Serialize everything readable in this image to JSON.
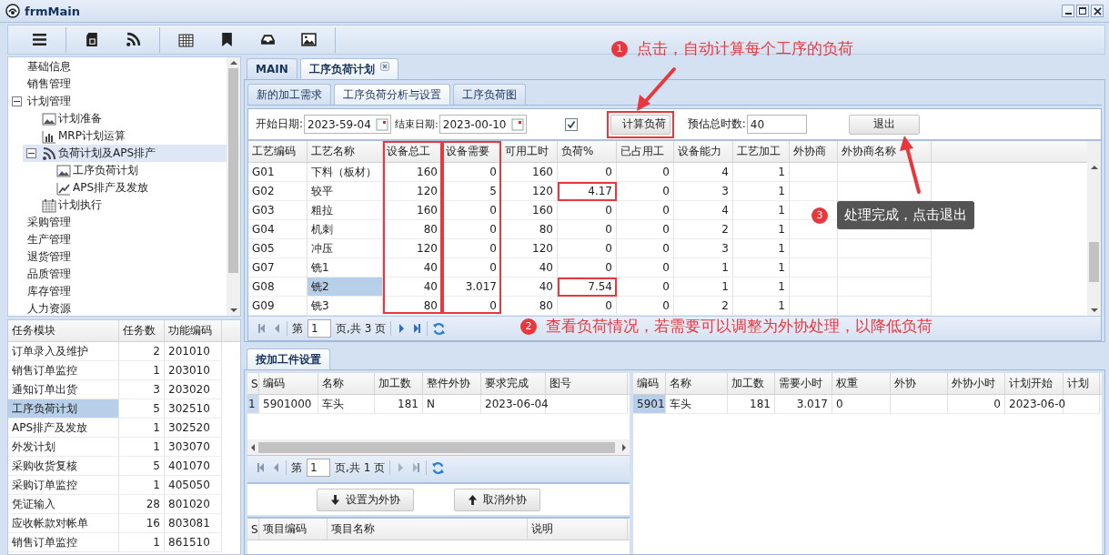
{
  "window": {
    "title": "frmMain"
  },
  "tree": [
    {
      "label": "基础信息",
      "selected": false
    },
    {
      "label": "销售管理",
      "selected": false
    },
    {
      "label": "计划管理",
      "selected": false,
      "expanded": true,
      "children": [
        {
          "label": "计划准备",
          "kind": "image",
          "selected": false
        },
        {
          "label": "MRP计划运算",
          "kind": "bars",
          "selected": false
        },
        {
          "label": "负荷计划及APS排产",
          "kind": "feed",
          "selected": true,
          "expanded": true,
          "children": [
            {
              "label": "工序负荷计划",
              "kind": "image",
              "selected": false
            },
            {
              "label": "APS排产及发放",
              "kind": "line",
              "selected": false
            }
          ]
        },
        {
          "label": "计划执行",
          "kind": "calendar",
          "selected": false
        }
      ]
    },
    {
      "label": "采购管理",
      "selected": false
    },
    {
      "label": "生产管理",
      "selected": false
    },
    {
      "label": "退货管理",
      "selected": false
    },
    {
      "label": "品质管理",
      "selected": false
    },
    {
      "label": "库存管理",
      "selected": false
    },
    {
      "label": "人力资源",
      "selected": false
    }
  ],
  "tasks": {
    "columns": [
      {
        "label": "任务模块",
        "kind": "text"
      },
      {
        "label": "任务数",
        "kind": "number"
      },
      {
        "label": "功能编码",
        "kind": "text"
      }
    ],
    "rows": [
      {
        "cells": [
          "订单录入及维护",
          "2",
          "201010"
        ],
        "selected": false
      },
      {
        "cells": [
          "销售订单监控",
          "1",
          "203010"
        ],
        "selected": false
      },
      {
        "cells": [
          "通知订单出货",
          "3",
          "203020"
        ],
        "selected": false
      },
      {
        "cells": [
          "工序负荷计划",
          "5",
          "302510"
        ],
        "selected": true
      },
      {
        "cells": [
          "APS排产及发放",
          "1",
          "302520"
        ],
        "selected": false
      },
      {
        "cells": [
          "外发计划",
          "1",
          "303070"
        ],
        "selected": false
      },
      {
        "cells": [
          "采购收货复核",
          "5",
          "401070"
        ],
        "selected": false
      },
      {
        "cells": [
          "采购订单监控",
          "1",
          "405050"
        ],
        "selected": false
      },
      {
        "cells": [
          "凭证输入",
          "28",
          "801020"
        ],
        "selected": false
      },
      {
        "cells": [
          "应收帐款对帐单",
          "16",
          "803081"
        ],
        "selected": false
      },
      {
        "cells": [
          "销售订单监控",
          "1",
          "861510"
        ],
        "selected": false
      }
    ]
  },
  "tabs": [
    {
      "label": "MAIN",
      "selected": false,
      "closable": false
    },
    {
      "label": "工序负荷计划",
      "selected": true,
      "closable": true
    }
  ],
  "subtabs": [
    {
      "label": "新的加工需求",
      "selected": false
    },
    {
      "label": "工序负荷分析与设置",
      "selected": true
    },
    {
      "label": "工序负荷图",
      "selected": false
    }
  ],
  "form": {
    "start_label": "开始日期:",
    "start_value": "2023-59-04",
    "end_label": "结束日期:",
    "end_value": "2023-00-10",
    "checked": true,
    "calc_button": "计算负荷",
    "calc_highlighted": true,
    "estimate_label": "预估总时数:",
    "estimate_value": "40",
    "exit_button": "退出"
  },
  "load_grid": {
    "columns": [
      {
        "label": "工艺编码",
        "kind": "text",
        "highlighted": false
      },
      {
        "label": "工艺名称",
        "kind": "text",
        "highlighted": false
      },
      {
        "label": "设备总工",
        "kind": "number",
        "highlighted": true
      },
      {
        "label": "设备需要",
        "kind": "number",
        "highlighted": true
      },
      {
        "label": "可用工时",
        "kind": "number",
        "highlighted": false
      },
      {
        "label": "负荷%",
        "kind": "number",
        "highlighted": false
      },
      {
        "label": "已占用工",
        "kind": "number",
        "highlighted": false
      },
      {
        "label": "设备能力",
        "kind": "number",
        "highlighted": false
      },
      {
        "label": "工艺加工",
        "kind": "number",
        "highlighted": false
      },
      {
        "label": "外协商",
        "highlighted": false
      },
      {
        "label": "外协商名称",
        "highlighted": false
      }
    ],
    "rows": [
      {
        "cells": [
          "G01",
          "下料（板材）",
          "160",
          "0",
          "160",
          "0",
          "0",
          "4",
          "1",
          "",
          ""
        ],
        "selected": false,
        "flagged": false
      },
      {
        "cells": [
          "G02",
          "较平",
          "120",
          "5",
          "120",
          "4.17",
          "0",
          "3",
          "1",
          "",
          ""
        ],
        "selected": false,
        "flagged": true
      },
      {
        "cells": [
          "G03",
          "粗拉",
          "160",
          "0",
          "160",
          "0",
          "0",
          "4",
          "1",
          "",
          ""
        ],
        "selected": false,
        "flagged": false
      },
      {
        "cells": [
          "G04",
          "机刺",
          "80",
          "0",
          "80",
          "0",
          "0",
          "2",
          "1",
          "",
          ""
        ],
        "selected": false,
        "flagged": false
      },
      {
        "cells": [
          "G05",
          "冲压",
          "120",
          "0",
          "120",
          "0",
          "0",
          "3",
          "1",
          "",
          ""
        ],
        "selected": false,
        "flagged": false
      },
      {
        "cells": [
          "G07",
          "铣1",
          "40",
          "0",
          "40",
          "0",
          "0",
          "1",
          "1",
          "",
          ""
        ],
        "selected": false,
        "flagged": false
      },
      {
        "cells": [
          "G08",
          "铣2",
          "40",
          "3.017",
          "40",
          "7.54",
          "0",
          "1",
          "1",
          "",
          ""
        ],
        "selected": true,
        "flagged": true
      },
      {
        "cells": [
          "G09",
          "铣3",
          "80",
          "0",
          "80",
          "0",
          "0",
          "2",
          "1",
          "",
          ""
        ],
        "selected": false,
        "flagged": false
      }
    ]
  },
  "pager": {
    "page_label": "第",
    "page": "1",
    "total": "页,共 3 页",
    "nav_enabled": true
  },
  "lower_tab": {
    "label": "按加工件设置",
    "selected": true
  },
  "parts_grid": {
    "columns": [
      {
        "label": "S",
        "kind": "text"
      },
      {
        "label": "编码",
        "kind": "text"
      },
      {
        "label": "名称",
        "kind": "text"
      },
      {
        "label": "加工数",
        "kind": "number"
      },
      {
        "label": "整件外协",
        "kind": "text"
      },
      {
        "label": "要求完成",
        "kind": "text"
      },
      {
        "label": "图号"
      }
    ],
    "rows": [
      {
        "cells": [
          "1",
          "5901000",
          "车头",
          "181",
          "N",
          "2023-06-04",
          ""
        ]
      }
    ]
  },
  "parts_pager": {
    "page_label": "第",
    "page": "1",
    "total": "页,共 1 页",
    "nav_enabled": false
  },
  "action_buttons": [
    {
      "label": "设置为外协",
      "kind": "down"
    },
    {
      "label": "取消外协",
      "kind": "up"
    }
  ],
  "items_grid": {
    "columns": [
      {
        "label": "S"
      },
      {
        "label": "项目编码"
      },
      {
        "label": "项目名称"
      },
      {
        "label": "说明"
      }
    ]
  },
  "detail_grid": {
    "columns": [
      {
        "label": "编码",
        "kind": "text"
      },
      {
        "label": "名称",
        "kind": "text"
      },
      {
        "label": "加工数",
        "kind": "number"
      },
      {
        "label": "需要小时",
        "kind": "number"
      },
      {
        "label": "权重",
        "kind": "text"
      },
      {
        "label": "外协"
      },
      {
        "label": "外协小时",
        "kind": "number"
      },
      {
        "label": "计划开始",
        "kind": "text"
      },
      {
        "label": "计划"
      }
    ],
    "rows": [
      {
        "cells": [
          "5901",
          "车头",
          "181",
          "3.017",
          "0",
          "",
          "0",
          "2023-06-0",
          ""
        ],
        "selected": true
      }
    ]
  },
  "annotations": [
    {
      "number": "1",
      "text": "点击，自动计算每个工序的负荷",
      "kind": "caption"
    },
    {
      "number": "3",
      "text": "处理完成，点击退出",
      "kind": "tooltip"
    },
    {
      "number": "2",
      "text": "查看负荷情况，若需要可以调整为外协处理，以降低负荷",
      "kind": "caption"
    }
  ]
}
